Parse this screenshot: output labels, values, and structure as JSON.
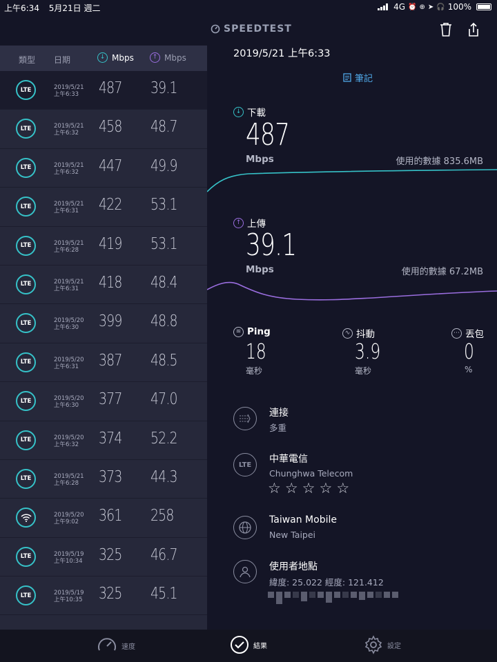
{
  "status_bar": {
    "time": "上午6:34",
    "date": "5月21日 週二",
    "network": "4G",
    "battery": "100%"
  },
  "header": {
    "brand": "SPEEDTEST"
  },
  "history": {
    "columns": {
      "type": "類型",
      "date": "日期",
      "download_unit": "Mbps",
      "upload_unit": "Mbps"
    },
    "rows": [
      {
        "kind": "LTE",
        "date": "2019/5/21",
        "time": "上午6:33",
        "download": "487",
        "upload": "39.1"
      },
      {
        "kind": "LTE",
        "date": "2019/5/21",
        "time": "上午6:32",
        "download": "458",
        "upload": "48.7"
      },
      {
        "kind": "LTE",
        "date": "2019/5/21",
        "time": "上午6:32",
        "download": "447",
        "upload": "49.9"
      },
      {
        "kind": "LTE",
        "date": "2019/5/21",
        "time": "上午6:31",
        "download": "422",
        "upload": "53.1"
      },
      {
        "kind": "LTE",
        "date": "2019/5/21",
        "time": "上午6:28",
        "download": "419",
        "upload": "53.1"
      },
      {
        "kind": "LTE",
        "date": "2019/5/21",
        "time": "上午6:31",
        "download": "418",
        "upload": "48.4"
      },
      {
        "kind": "LTE",
        "date": "2019/5/20",
        "time": "上午6:30",
        "download": "399",
        "upload": "48.8"
      },
      {
        "kind": "LTE",
        "date": "2019/5/20",
        "time": "上午6:31",
        "download": "387",
        "upload": "48.5"
      },
      {
        "kind": "LTE",
        "date": "2019/5/20",
        "time": "上午6:30",
        "download": "377",
        "upload": "47.0"
      },
      {
        "kind": "LTE",
        "date": "2019/5/20",
        "time": "上午6:32",
        "download": "374",
        "upload": "52.2"
      },
      {
        "kind": "LTE",
        "date": "2019/5/21",
        "time": "上午6:28",
        "download": "373",
        "upload": "44.3"
      },
      {
        "kind": "wifi",
        "date": "2019/5/20",
        "time": "上午9:02",
        "download": "361",
        "upload": "258"
      },
      {
        "kind": "LTE",
        "date": "2019/5/19",
        "time": "上午10:34",
        "download": "325",
        "upload": "46.7"
      },
      {
        "kind": "LTE",
        "date": "2019/5/19",
        "time": "上午10:35",
        "download": "325",
        "upload": "45.1"
      }
    ]
  },
  "result": {
    "timestamp": "2019/5/21 上午6:33",
    "notes_label": "筆記",
    "download": {
      "label": "下載",
      "value": "487",
      "unit": "Mbps",
      "data_used": "使用的數據 835.6MB"
    },
    "upload": {
      "label": "上傳",
      "value": "39.1",
      "unit": "Mbps",
      "data_used": "使用的數據 67.2MB"
    },
    "ping": {
      "label": "Ping",
      "value": "18",
      "unit": "毫秒"
    },
    "jitter": {
      "label": "抖動",
      "value": "3.9",
      "unit": "毫秒"
    },
    "loss": {
      "label": "丟包",
      "value": "0",
      "unit": "%"
    },
    "connection": {
      "title": "連接",
      "subtitle": "多重"
    },
    "provider": {
      "title": "中華電信",
      "subtitle": "Chunghwa Telecom",
      "icon_text": "LTE",
      "rating": 0
    },
    "server": {
      "title": "Taiwan Mobile",
      "subtitle": "New Taipei"
    },
    "location": {
      "title": "使用者地點",
      "coords": "緯度: 25.022  經度: 121.412"
    }
  },
  "tabs": {
    "speed": "速度",
    "results": "結果",
    "settings": "設定"
  },
  "colors": {
    "download": "#36c2c8",
    "upload": "#9b6ee0",
    "accent": "#4fa8e8"
  }
}
